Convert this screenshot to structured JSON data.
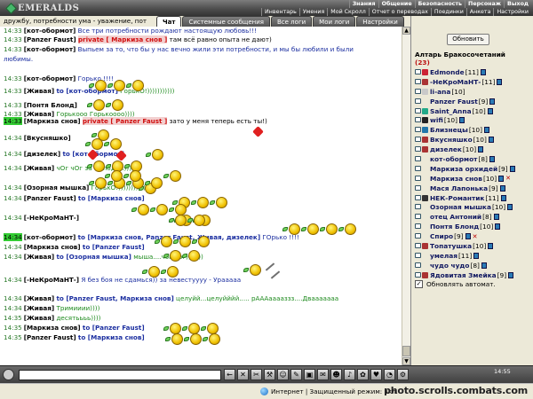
{
  "app": {
    "logo": "EMERALDS"
  },
  "menu": {
    "top": [
      "Знания",
      "Общение",
      "Безопасность",
      "Персонаж",
      "Выход"
    ],
    "bottom": [
      "Инвентарь",
      "Умения",
      "Мой Скролл",
      "Отчет о переводах",
      "Поединки",
      "Анкета",
      "Настройки"
    ]
  },
  "tabs": [
    {
      "label": "Чат",
      "active": true
    },
    {
      "label": "Системные сообщения",
      "active": false
    },
    {
      "label": "Все логи",
      "active": false
    },
    {
      "label": "Мои логи",
      "active": false
    },
    {
      "label": "Настройки",
      "active": false
    }
  ],
  "chat": {
    "fragment": "дружбу, потребности ума - уважение, пот",
    "lines": [
      {
        "time": "14:33",
        "nick": "[кот-обормот]",
        "text": "Все три потребности рождают настоящую любовь!!!",
        "style": "blue"
      },
      {
        "time": "14:33",
        "nick": "[Panzer Faust]",
        "priv": "private [ Маркиза снов ]",
        "text": "там всё равно опыта не дают)",
        "style": "black"
      },
      {
        "time": "14:33",
        "nick": "[кот-обормот]",
        "text": "Выпьем за то, что бы у нас вечно жили эти потребности, и мы бы любили и были",
        "style": "blue"
      },
      {
        "time": "",
        "nick": "",
        "text": "любимы.",
        "style": "blue"
      },
      {
        "time": "14:33",
        "nick": "[кот-обормот]",
        "text": "Горько !!!!",
        "style": "blue"
      },
      {
        "time": "14:33",
        "nick": "[Живая]",
        "to": "to [кот-обормот]",
        "text": "ГорькО!)))))))))))",
        "style": "green"
      },
      {
        "time": "14:33",
        "nick": "[Понтя Блонд]",
        "text": "",
        "style": "black"
      },
      {
        "time": "14:33",
        "nick": "[Живая]",
        "text": "Горькооо Горькоооо))))",
        "style": "green"
      },
      {
        "time": "14:33",
        "nick": "[Маркиза снов]",
        "priv": "private [ Panzer Faust ]",
        "text": "зато у меня теперь есть ты!)",
        "style": "black",
        "hl": true
      },
      {
        "time": "14:34",
        "nick": "[Вкусняшко]",
        "text": "",
        "style": "black"
      },
      {
        "time": "14:34",
        "nick": "[дизелек]",
        "to": "to [кот-обормот]",
        "text": "",
        "style": "black"
      },
      {
        "time": "14:34",
        "nick": "[Живая]",
        "text": "чОг чОг за молодых))))",
        "style": "green"
      },
      {
        "time": "14:34",
        "nick": "[Озорная мышка]",
        "text": "ГорькО!))))))))))))",
        "style": "green"
      },
      {
        "time": "14:34",
        "nick": "[Panzer Faust]",
        "to": "to [Маркиза снов]",
        "text": "",
        "style": "black"
      },
      {
        "time": "14:34",
        "nick": "[-НеКроМаНТ-]",
        "text": "",
        "style": "black"
      },
      {
        "time": "14:34",
        "nick": "[кот-обормот]",
        "to": "to [Маркиза снов, Panzer Faust, Живая, дизелек]",
        "text": "ГОрько !!!!",
        "style": "blue",
        "hl": true
      },
      {
        "time": "14:34",
        "nick": "[Маркиза снов]",
        "to": "to [Panzer Faust]",
        "text": "",
        "style": "black"
      },
      {
        "time": "14:34",
        "nick": "[Живая]",
        "to": "to [Озорная мышка]",
        "text": "мыша....чоГ чог)))))))",
        "style": "green"
      },
      {
        "time": "14:34",
        "nick": "[-НеКроМаНТ-]",
        "text": "Я без боя не сдамься)) за невестуууу - Урааааа",
        "style": "blue"
      },
      {
        "time": "14:34",
        "nick": "[Живая]",
        "to": "to [Panzer Faust, Маркиза снов]",
        "text": "целуйй...целуйййй..... рАААааааззз....Двааааааа",
        "style": "green"
      },
      {
        "time": "14:34",
        "nick": "[Живая]",
        "text": "Тримииии))))",
        "style": "green"
      },
      {
        "time": "14:35",
        "nick": "[Живая]",
        "text": "десятьььь))))",
        "style": "green"
      },
      {
        "time": "14:35",
        "nick": "[Маркиза снов]",
        "to": "to [Panzer Faust]",
        "text": "",
        "style": "black"
      },
      {
        "time": "14:35",
        "nick": "[Panzer Faust]",
        "to": "to [Маркиза снов]",
        "text": "",
        "style": "black"
      }
    ]
  },
  "sidebar": {
    "refresh_label": "Обновить",
    "room_title": "Алтарь Бракосочетаний",
    "room_count": "(23)",
    "users": [
      {
        "name": "Edmonde",
        "level": "[11]",
        "clan": "#c23",
        "badge": true
      },
      {
        "name": "-НеКроМаНТ-",
        "level": "[11]",
        "clan": "#a33",
        "badge": true
      },
      {
        "name": "li-ana",
        "level": "[10]",
        "clan": "#c9c9c9",
        "badge": false
      },
      {
        "name": "Panzer Faust",
        "level": "[9]",
        "clan": "",
        "badge": true
      },
      {
        "name": "Saint_Anna",
        "level": "[10]",
        "clan": "#2a8",
        "badge": true
      },
      {
        "name": "wifi",
        "level": "[10]",
        "clan": "#222",
        "badge": true
      },
      {
        "name": "Близнецы",
        "level": "[10]",
        "clan": "#27a",
        "badge": true
      },
      {
        "name": "Вкусняшко",
        "level": "[10]",
        "clan": "#a33",
        "badge": true
      },
      {
        "name": "дизелек",
        "level": "[10]",
        "clan": "#a33",
        "badge": true
      },
      {
        "name": "кот-обормот",
        "level": "[8]",
        "clan": "",
        "badge": true
      },
      {
        "name": "Маркиза орхидей",
        "level": "[9]",
        "clan": "",
        "badge": true
      },
      {
        "name": "Маркиза снов",
        "level": "[10]",
        "clan": "",
        "badge": true,
        "x": true
      },
      {
        "name": "Мася Лапонька",
        "level": "[9]",
        "clan": "",
        "badge": true
      },
      {
        "name": "НЕК-Романтик",
        "level": "[11]",
        "clan": "#333",
        "badge": true
      },
      {
        "name": "Озорная мышка",
        "level": "[10]",
        "clan": "",
        "badge": true
      },
      {
        "name": "отец Антоний",
        "level": "[8]",
        "clan": "",
        "badge": true
      },
      {
        "name": "Понтя Блонд",
        "level": "[10]",
        "clan": "",
        "badge": true
      },
      {
        "name": "Спиро",
        "level": "[9]",
        "clan": "",
        "badge": true,
        "x": true
      },
      {
        "name": "Топатушка",
        "level": "[10]",
        "clan": "#a33",
        "badge": true
      },
      {
        "name": "умелая",
        "level": "[11]",
        "clan": "",
        "badge": true
      },
      {
        "name": "чудо чудо",
        "level": "[8]",
        "clan": "",
        "badge": true
      },
      {
        "name": "Ядовитая Змейка",
        "level": "[9]",
        "clan": "#a33",
        "badge": true
      }
    ],
    "autoupdate_label": "Обновлять автомат."
  },
  "toolbar": {
    "tools": [
      "arrow-left-icon",
      "cross-icon",
      "scissors-icon",
      "hammer-icon",
      "person-icon",
      "pen-icon",
      "box-icon",
      "chat-icon",
      "smile-icon",
      "music-icon",
      "gift-icon",
      "heart-icon",
      "clock-icon",
      "gear-icon"
    ],
    "clock": "14:55"
  },
  "statusbar": {
    "zone_text": "Интернет | Защищенный режим: вкл.",
    "watermark": "photo.scrolls.combats.com"
  }
}
